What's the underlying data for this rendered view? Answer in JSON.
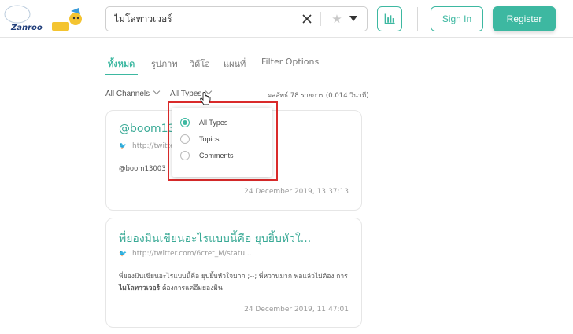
{
  "header": {
    "logo_text": "Zanroo",
    "search_value": "ไมโลทาวเวอร์",
    "signin_label": "Sign In",
    "register_label": "Register"
  },
  "tabs": [
    {
      "label": "ทั้งหมด",
      "active": true
    },
    {
      "label": "รูปภาพ",
      "active": false
    },
    {
      "label": "วิดีโอ",
      "active": false
    },
    {
      "label": "แผนที่",
      "active": false
    },
    {
      "label": "Filter Options",
      "active": false
    }
  ],
  "filters": {
    "channels": "All Channels",
    "types": "All Types",
    "results": "ผลลัพธ์ 78 รายการ (0.014 วินาที)"
  },
  "dropdown": {
    "options": [
      {
        "label": "All Types",
        "selected": true
      },
      {
        "label": "Topics",
        "selected": false
      },
      {
        "label": "Comments",
        "selected": false
      }
    ]
  },
  "posts": [
    {
      "title": "@boom130",
      "link": "http://twitte",
      "text": "@boom13003",
      "date": "24 December 2019, 13:37:13"
    },
    {
      "title": "พี่ยองมินเขียนอะไรแบบนี้คือ ยุบยิ้บหัวใ...",
      "link": "http://twitter.com/6cret_M/statu...",
      "text_pre": "พี่ยองมินเขียนอะไรแบบนี้คือ ยุบยิ้บหัวใจมาก ;--; พี่หวานมาก พอแล้วไม่ต้อง การ",
      "text_bold": "ไมโลทาวเวอร์",
      "text_post": " ต้องการแค่อึมยองมิน",
      "date": "24 December 2019, 11:47:01"
    }
  ],
  "colors": {
    "accent": "#3db8a1",
    "highlight": "#d92a2a"
  }
}
